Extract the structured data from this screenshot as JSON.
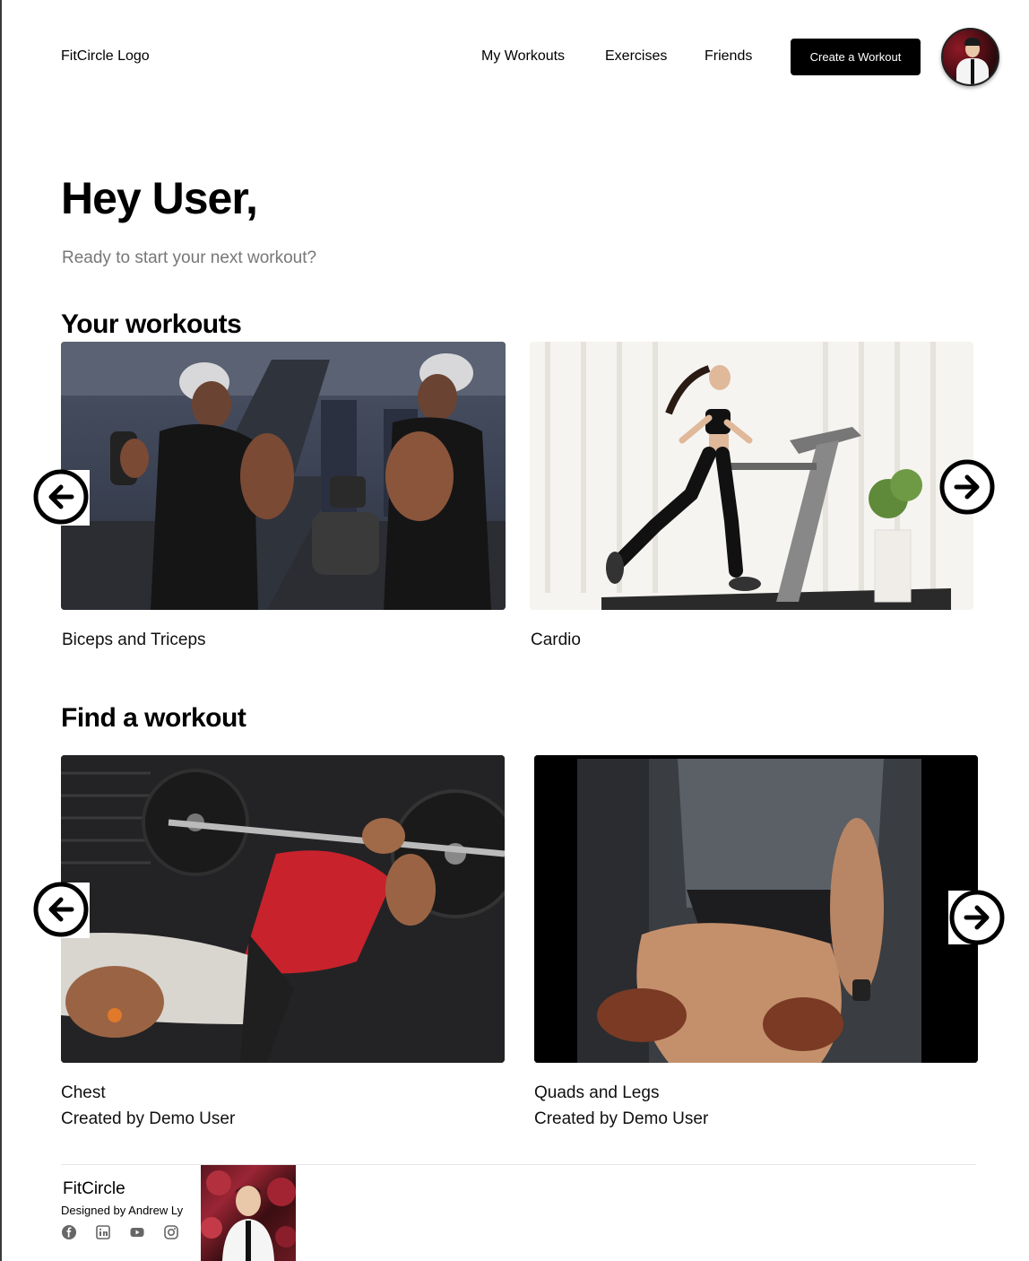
{
  "header": {
    "logo": "FitCircle Logo",
    "nav": [
      "My Workouts",
      "Exercises",
      "Friends"
    ],
    "create_button": "Create a Workout"
  },
  "hero": {
    "greeting": "Hey User,",
    "subtitle": "Ready to start your next workout?"
  },
  "your_workouts": {
    "title": "Your workouts",
    "cards": [
      {
        "label": "Biceps and Triceps"
      },
      {
        "label": "Cardio"
      }
    ]
  },
  "find_workout": {
    "title": "Find a workout",
    "cards": [
      {
        "label": "Chest",
        "creator": "Created by Demo User"
      },
      {
        "label": "Quads and Legs",
        "creator": "Created by Demo User"
      }
    ]
  },
  "footer": {
    "brand": "FitCircle",
    "credit": "Designed by Andrew Ly",
    "social_icons": [
      "facebook-icon",
      "linkedin-icon",
      "youtube-icon",
      "instagram-icon"
    ]
  },
  "colors": {
    "primary": "#000000",
    "background": "#ffffff",
    "muted_text": "#777777"
  }
}
